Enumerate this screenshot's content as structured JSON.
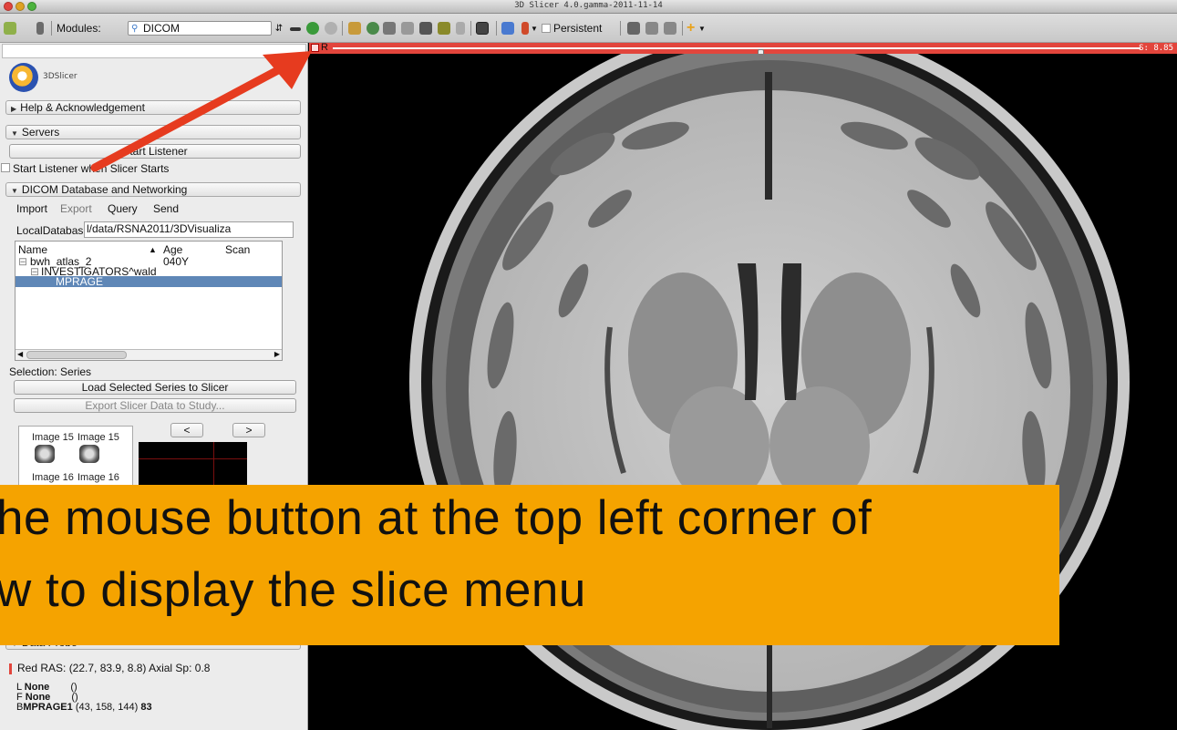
{
  "window": {
    "title": "3D Slicer 4.0.gamma-2011-11-14"
  },
  "toolbar": {
    "modules_label": "Modules:",
    "module_selected": "DICOM",
    "persistent_label": "Persistent"
  },
  "panel": {
    "logo_text": "3DSlicer",
    "sections": {
      "help": "Help & Acknowledgement",
      "servers": "Servers",
      "dicom_db": "DICOM Database and Networking",
      "data_probe": "Data Probe"
    },
    "servers": {
      "start_listener_button": "Start Listener",
      "start_on_launch_label": "Start Listener when Slicer Starts"
    },
    "tabs": [
      "Import",
      "Export",
      "Query",
      "Send"
    ],
    "local_db_label": "LocalDatabase",
    "local_db_value": "l/data/RSNA2011/3DVisualiza",
    "tree": {
      "columns": [
        "Name",
        "Age",
        "Scan"
      ],
      "rows": [
        {
          "name": "bwh_atlas_2",
          "age": "040Y"
        },
        {
          "name": "INVESTIGATORS^wald",
          "age": ""
        },
        {
          "name": "MPRAGE",
          "age": ""
        }
      ]
    },
    "selection_label": "Selection: Series",
    "load_button": "Load Selected Series to Slicer",
    "export_button": "Export Slicer Data to Study...",
    "thumbnails": [
      "Image 15",
      "Image 15",
      "Image 16",
      "Image 16"
    ],
    "nav_prev": "<",
    "nav_next": ">",
    "probe": {
      "ras_line": "Red  RAS: (22.7, 83.9, 8.8)  Axial Sp: 0.8",
      "layers": [
        {
          "prefix": "L",
          "name": "None",
          "coords": "()",
          "value": ""
        },
        {
          "prefix": "F",
          "name": "None",
          "coords": "()",
          "value": ""
        },
        {
          "prefix": "B",
          "name": "MPRAGE1",
          "coords": "(43, 158, 144)",
          "value": "83"
        }
      ]
    }
  },
  "slice_view": {
    "name": "R",
    "offset": "S: 8.85",
    "slider_fraction": 0.53,
    "accent_color": "#e2453c"
  },
  "caption": {
    "line1": "he mouse button at the top left corner of",
    "line2": "w to display the slice menu",
    "background": "#f5a300"
  }
}
